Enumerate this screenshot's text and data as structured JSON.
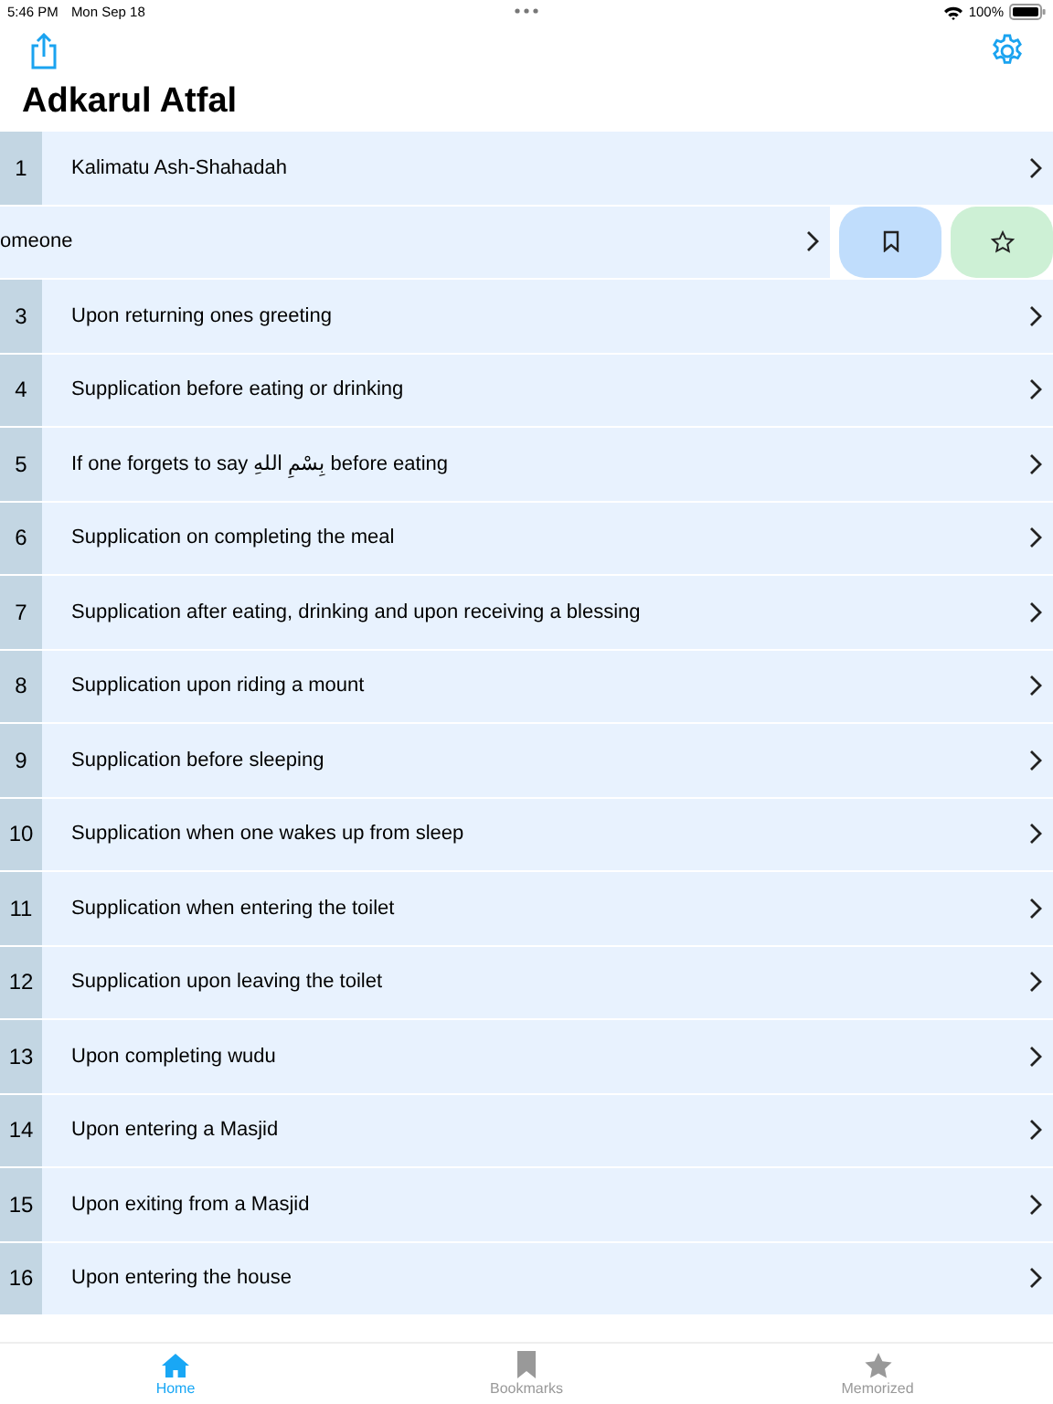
{
  "status_bar": {
    "time": "5:46 PM",
    "date": "Mon Sep 18",
    "battery": "100%"
  },
  "title": "Adkarul Atfal",
  "rows": [
    {
      "kind": "normal",
      "number": "1",
      "text": "Kalimatu Ash-Shahadah"
    },
    {
      "kind": "swiped",
      "text": "omeone"
    },
    {
      "kind": "normal",
      "number": "3",
      "text": "Upon returning ones greeting"
    },
    {
      "kind": "normal",
      "number": "4",
      "text": "Supplication before eating or drinking"
    },
    {
      "kind": "normal",
      "number": "5",
      "text": "If one forgets to say بِسْمِ اللهِ before eating"
    },
    {
      "kind": "normal",
      "number": "6",
      "text": "Supplication on completing the meal"
    },
    {
      "kind": "normal",
      "number": "7",
      "text": "Supplication after eating, drinking and upon receiving a blessing"
    },
    {
      "kind": "normal",
      "number": "8",
      "text": "Supplication upon riding a mount"
    },
    {
      "kind": "normal",
      "number": "9",
      "text": "Supplication before sleeping"
    },
    {
      "kind": "normal",
      "number": "10",
      "text": "Supplication when one wakes up from sleep"
    },
    {
      "kind": "normal",
      "number": "11",
      "text": "Supplication when entering the toilet"
    },
    {
      "kind": "normal",
      "number": "12",
      "text": "Supplication upon leaving the toilet"
    },
    {
      "kind": "normal",
      "number": "13",
      "text": "Upon completing wudu"
    },
    {
      "kind": "normal",
      "number": "14",
      "text": "Upon entering a Masjid"
    },
    {
      "kind": "normal",
      "number": "15",
      "text": "Upon exiting from a Masjid"
    },
    {
      "kind": "normal",
      "number": "16",
      "text": "Upon entering the house"
    }
  ],
  "tabs": [
    {
      "label": "Home",
      "kind": "home",
      "selected": true
    },
    {
      "label": "Bookmarks",
      "kind": "bookmarks",
      "selected": false
    },
    {
      "label": "Memorized",
      "kind": "memorized",
      "selected": false
    }
  ]
}
